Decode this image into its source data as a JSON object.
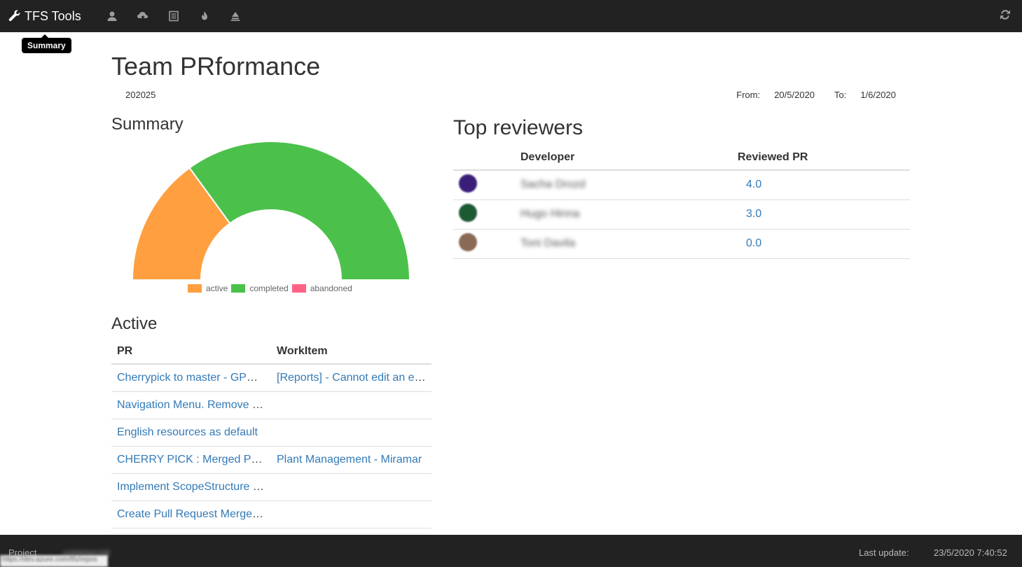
{
  "nav": {
    "brand": "TFS Tools",
    "icons": [
      "user-icon",
      "cloud-upload-icon",
      "list-icon",
      "fire-icon",
      "eject-icon"
    ],
    "tooltip": "Summary",
    "refresh_icon": "refresh-icon"
  },
  "page": {
    "title": "Team PRformance",
    "period": "202025",
    "from_label": "From:",
    "from": "20/5/2020",
    "to_label": "To:",
    "to": "1/6/2020"
  },
  "summary": {
    "heading": "Summary",
    "chart_data": {
      "type": "pie",
      "variant": "half-doughnut",
      "labels": [
        "active",
        "completed",
        "abandoned"
      ],
      "values": [
        6,
        14,
        0
      ],
      "colors": [
        "#ff9f40",
        "#4bc14b",
        "#ff6384"
      ],
      "legend": "bottom"
    }
  },
  "active": {
    "heading": "Active",
    "columns": [
      "PR",
      "WorkItem"
    ],
    "rows": [
      {
        "pr": "Cherrypick to master - GPM-Fix product family...",
        "workitem": "[Reports] - Cannot edit an existing report"
      },
      {
        "pr": "Navigation Menu. Remove unused items",
        "workitem": ""
      },
      {
        "pr": "English resources as default",
        "workitem": ""
      },
      {
        "pr": "CHERRY PICK : Merged PR into master",
        "workitem": "Plant Management - Miramar"
      },
      {
        "pr": "Implement ScopeStructure changes",
        "workitem": ""
      },
      {
        "pr": "Create Pull Request Merge policy",
        "workitem": ""
      }
    ]
  },
  "reviewers": {
    "heading": "Top reviewers",
    "columns": [
      "Developer",
      "Reviewed PR"
    ],
    "rows": [
      {
        "name": "Sacha Drozd",
        "value": "4.0",
        "color": "#3b1e7a"
      },
      {
        "name": "Hugo Hinna",
        "value": "3.0",
        "color": "#1d5a34"
      },
      {
        "name": "Toni Davila",
        "value": "0.0",
        "color": "#8a6a55"
      }
    ]
  },
  "footer": {
    "project_label": "Project",
    "project_value": "commercial",
    "last_update_label": "Last update:",
    "last_update": "23/5/2020 7:40:52"
  },
  "statusbar": {
    "url": "https://dev.azure.com/tfs/repos"
  }
}
